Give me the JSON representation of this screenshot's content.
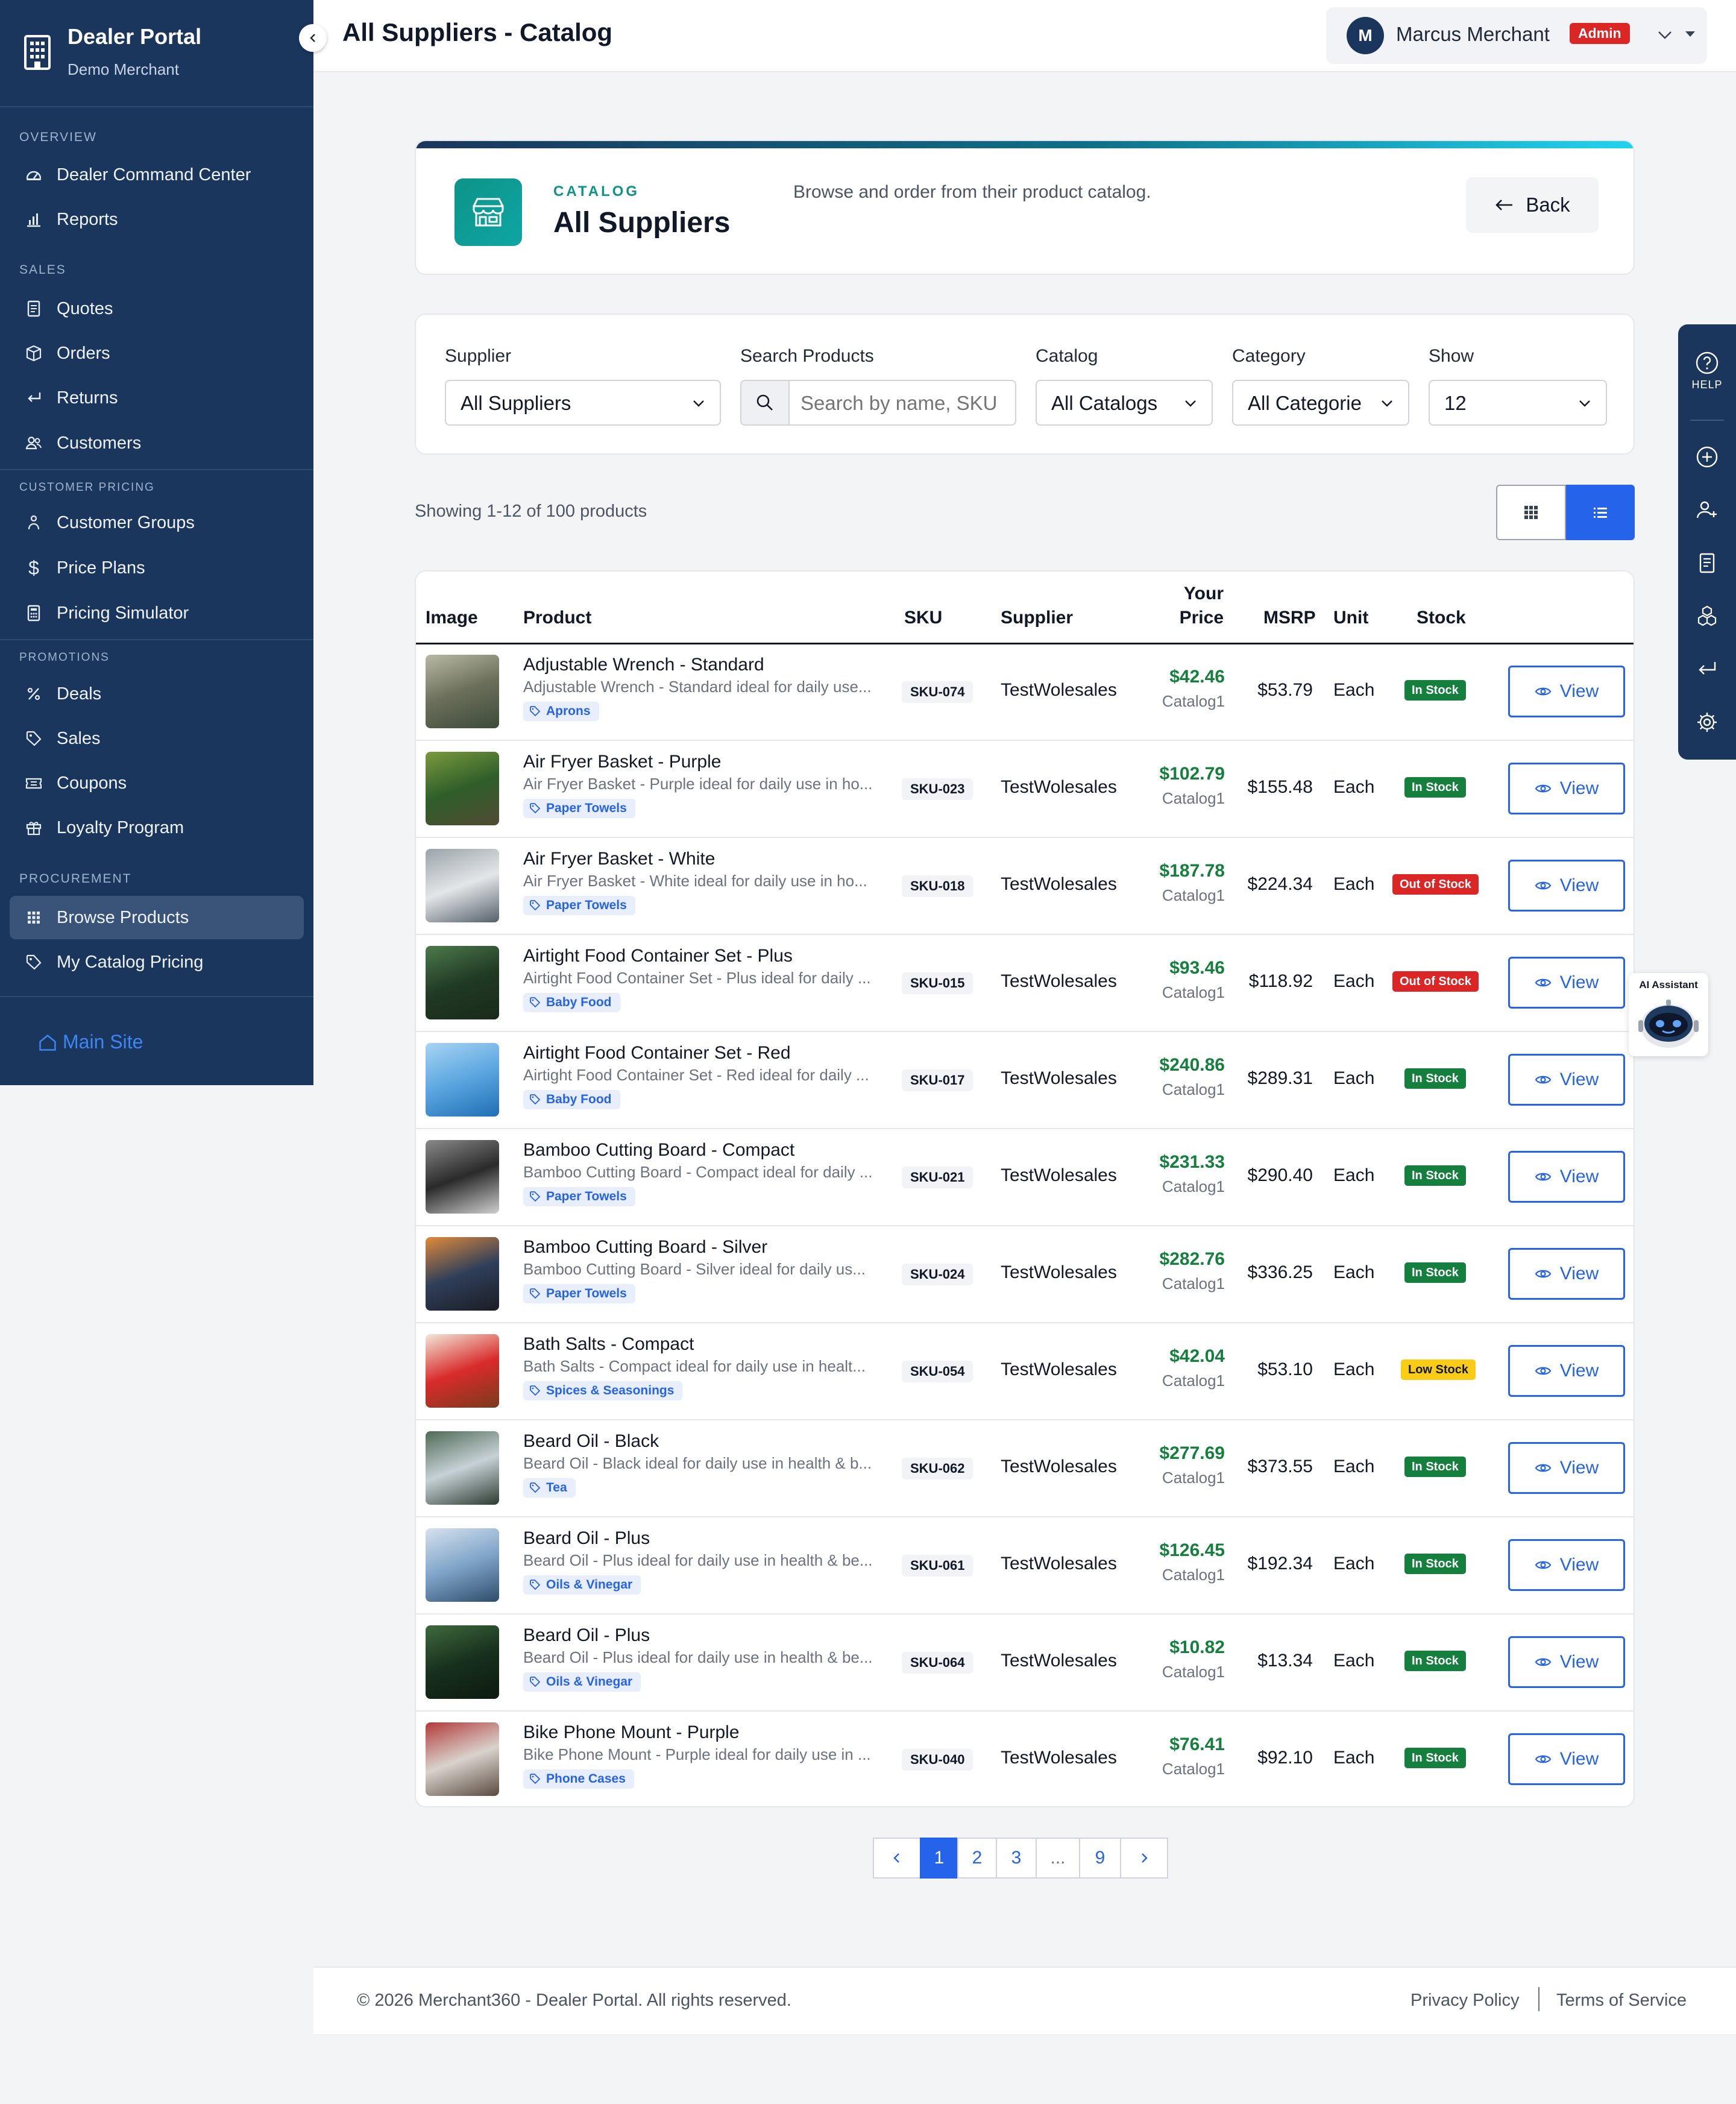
{
  "brand": {
    "title": "Dealer Portal",
    "subtitle": "Demo Merchant"
  },
  "sidebar": {
    "sections": [
      {
        "label": "OVERVIEW"
      },
      {
        "label": "SALES"
      },
      {
        "label": "CUSTOMER PRICING"
      },
      {
        "label": "PROMOTIONS"
      },
      {
        "label": "PROCUREMENT"
      }
    ],
    "items": [
      {
        "label": "Dealer Command Center",
        "icon": "gauge-icon"
      },
      {
        "label": "Reports",
        "icon": "bar-chart-icon"
      },
      {
        "label": "Quotes",
        "icon": "document-icon"
      },
      {
        "label": "Orders",
        "icon": "box-icon"
      },
      {
        "label": "Returns",
        "icon": "return-icon"
      },
      {
        "label": "Customers",
        "icon": "users-icon"
      },
      {
        "label": "Customer Groups",
        "icon": "group-icon"
      },
      {
        "label": "Price Plans",
        "icon": "dollar-icon"
      },
      {
        "label": "Pricing Simulator",
        "icon": "calculator-icon"
      },
      {
        "label": "Deals",
        "icon": "percent-icon"
      },
      {
        "label": "Sales",
        "icon": "tag-icon"
      },
      {
        "label": "Coupons",
        "icon": "ticket-icon"
      },
      {
        "label": "Loyalty Program",
        "icon": "gift-icon"
      },
      {
        "label": "Browse Products",
        "icon": "grid-icon",
        "active": true
      },
      {
        "label": "My Catalog Pricing",
        "icon": "tag-icon"
      }
    ],
    "main_site": "Main Site"
  },
  "topbar": {
    "title": "All Suppliers - Catalog",
    "user": {
      "initial": "M",
      "name": "Marcus Merchant",
      "role": "Admin"
    }
  },
  "header_card": {
    "eyebrow": "CATALOG",
    "title": "All Suppliers",
    "description": "Browse and order from their product catalog.",
    "back_label": "Back"
  },
  "filters": {
    "supplier": {
      "label": "Supplier",
      "value": "All Suppliers"
    },
    "search": {
      "label": "Search Products",
      "placeholder": "Search by name, SKU"
    },
    "catalog": {
      "label": "Catalog",
      "value": "All Catalogs"
    },
    "category": {
      "label": "Category",
      "value": "All Categorie"
    },
    "show": {
      "label": "Show",
      "value": "12"
    }
  },
  "showing": "Showing 1-12 of 100 products",
  "table": {
    "headers": {
      "image": "Image",
      "product": "Product",
      "sku": "SKU",
      "supplier": "Supplier",
      "price_1": "Your",
      "price_2": "Price",
      "msrp": "MSRP",
      "unit": "Unit",
      "stock": "Stock"
    },
    "view_label": "View",
    "rows": [
      {
        "name": "Adjustable Wrench - Standard",
        "desc": "Adjustable Wrench - Standard ideal for daily use...",
        "tag": "Aprons",
        "sku": "SKU-074",
        "supplier": "TestWolesales",
        "price": "$42.46",
        "catalog": "Catalog1",
        "msrp": "$53.79",
        "unit": "Each",
        "stock": "In Stock",
        "img": [
          "#6b6f5a",
          "#b8b9a4",
          "#3d4a3a"
        ]
      },
      {
        "name": "Air Fryer Basket - Purple",
        "desc": "Air Fryer Basket - Purple ideal for daily use in ho...",
        "tag": "Paper Towels",
        "sku": "SKU-023",
        "supplier": "TestWolesales",
        "price": "$102.79",
        "catalog": "Catalog1",
        "msrp": "$155.48",
        "unit": "Each",
        "stock": "In Stock",
        "img": [
          "#2f5e2a",
          "#7a9a3e",
          "#514a32"
        ]
      },
      {
        "name": "Air Fryer Basket - White",
        "desc": "Air Fryer Basket - White ideal for daily use in ho...",
        "tag": "Paper Towels",
        "sku": "SKU-018",
        "supplier": "TestWolesales",
        "price": "$187.78",
        "catalog": "Catalog1",
        "msrp": "$224.34",
        "unit": "Each",
        "stock": "Out of Stock",
        "img": [
          "#e3e6e8",
          "#9aa3a8",
          "#55606a"
        ]
      },
      {
        "name": "Airtight Food Container Set - Plus",
        "desc": "Airtight Food Container Set - Plus ideal for daily ...",
        "tag": "Baby Food",
        "sku": "SKU-015",
        "supplier": "TestWolesales",
        "price": "$93.46",
        "catalog": "Catalog1",
        "msrp": "$118.92",
        "unit": "Each",
        "stock": "Out of Stock",
        "img": [
          "#203a24",
          "#4d7a4c",
          "#1a2a1b"
        ]
      },
      {
        "name": "Airtight Food Container Set - Red",
        "desc": "Airtight Food Container Set - Red ideal for daily ...",
        "tag": "Baby Food",
        "sku": "SKU-017",
        "supplier": "TestWolesales",
        "price": "$240.86",
        "catalog": "Catalog1",
        "msrp": "$289.31",
        "unit": "Each",
        "stock": "In Stock",
        "img": [
          "#5ba6e0",
          "#a7d4f3",
          "#1f6fb5"
        ]
      },
      {
        "name": "Bamboo Cutting Board - Compact",
        "desc": "Bamboo Cutting Board - Compact ideal for daily ...",
        "tag": "Paper Towels",
        "sku": "SKU-021",
        "supplier": "TestWolesales",
        "price": "$231.33",
        "catalog": "Catalog1",
        "msrp": "$290.40",
        "unit": "Each",
        "stock": "In Stock",
        "img": [
          "#2a2a2a",
          "#8a8a8a",
          "#cfcfcf"
        ]
      },
      {
        "name": "Bamboo Cutting Board - Silver",
        "desc": "Bamboo Cutting Board - Silver ideal for daily us...",
        "tag": "Paper Towels",
        "sku": "SKU-024",
        "supplier": "TestWolesales",
        "price": "$282.76",
        "catalog": "Catalog1",
        "msrp": "$336.25",
        "unit": "Each",
        "stock": "In Stock",
        "img": [
          "#2f3f5a",
          "#e08a3a",
          "#1b1d24"
        ]
      },
      {
        "name": "Bath Salts - Compact",
        "desc": "Bath Salts - Compact ideal for daily use in healt...",
        "tag": "Spices & Seasonings",
        "sku": "SKU-054",
        "supplier": "TestWolesales",
        "price": "$42.04",
        "catalog": "Catalog1",
        "msrp": "$53.10",
        "unit": "Each",
        "stock": "Low Stock",
        "img": [
          "#d92b2b",
          "#f2e7d8",
          "#7a3b1c"
        ]
      },
      {
        "name": "Beard Oil - Black",
        "desc": "Beard Oil - Black ideal for daily use in health & b...",
        "tag": "Tea",
        "sku": "SKU-062",
        "supplier": "TestWolesales",
        "price": "$277.69",
        "catalog": "Catalog1",
        "msrp": "$373.55",
        "unit": "Each",
        "stock": "In Stock",
        "img": [
          "#c7d1d6",
          "#4e6a55",
          "#2c3a30"
        ]
      },
      {
        "name": "Beard Oil - Plus",
        "desc": "Beard Oil - Plus ideal for daily use in health & be...",
        "tag": "Oils & Vinegar",
        "sku": "SKU-061",
        "supplier": "TestWolesales",
        "price": "$126.45",
        "catalog": "Catalog1",
        "msrp": "$192.34",
        "unit": "Each",
        "stock": "In Stock",
        "img": [
          "#7fa4c8",
          "#d6e2ee",
          "#2f4d6b"
        ]
      },
      {
        "name": "Beard Oil - Plus",
        "desc": "Beard Oil - Plus ideal for daily use in health & be...",
        "tag": "Oils & Vinegar",
        "sku": "SKU-064",
        "supplier": "TestWolesales",
        "price": "$10.82",
        "catalog": "Catalog1",
        "msrp": "$13.34",
        "unit": "Each",
        "stock": "In Stock",
        "img": [
          "#17301d",
          "#3f6a3c",
          "#0d1a10"
        ]
      },
      {
        "name": "Bike Phone Mount - Purple",
        "desc": "Bike Phone Mount - Purple ideal for daily use in ...",
        "tag": "Phone Cases",
        "sku": "SKU-040",
        "supplier": "TestWolesales",
        "price": "$76.41",
        "catalog": "Catalog1",
        "msrp": "$92.10",
        "unit": "Each",
        "stock": "In Stock",
        "img": [
          "#d8d3cc",
          "#b33a3a",
          "#5a4a40"
        ]
      }
    ]
  },
  "stock_colors": {
    "In Stock": {
      "bg": "#15803d",
      "fg": "#ffffff"
    },
    "Out of Stock": {
      "bg": "#dc2626",
      "fg": "#ffffff"
    },
    "Low Stock": {
      "bg": "#facc15",
      "fg": "#111827"
    }
  },
  "pagination": {
    "pages": [
      "1",
      "2",
      "3",
      "...",
      "9"
    ],
    "current": "1"
  },
  "footer": {
    "copyright": "© 2026 Merchant360 - Dealer Portal. All rights reserved.",
    "privacy": "Privacy Policy",
    "terms": "Terms of Service"
  },
  "rail": {
    "help_label": "HELP"
  },
  "ai_assistant": {
    "label": "AI Assistant"
  },
  "colors": {
    "sidebar": "#1b365d",
    "accent": "#2563eb",
    "price": "#15803d"
  }
}
